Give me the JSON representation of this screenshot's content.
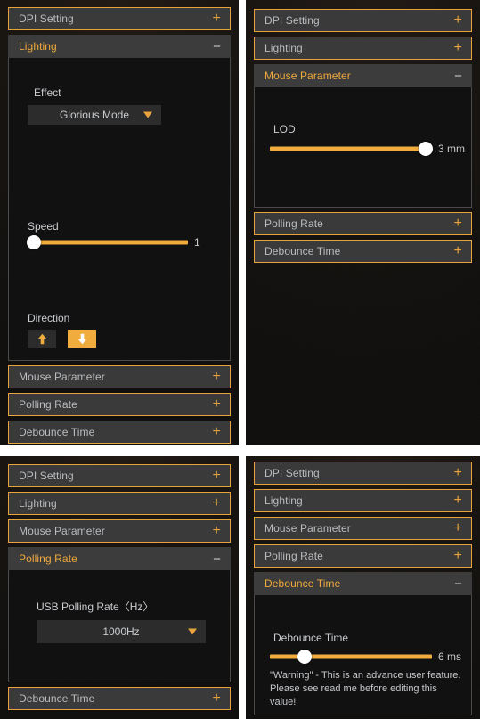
{
  "colors": {
    "accent": "#e8a33d",
    "accent_bright": "#f0ad3e",
    "header_bg": "#3a3a3a",
    "panel_bg": "#121111",
    "text": "#c9ccd0",
    "knob": "#ffffff"
  },
  "sections": {
    "dpi_setting": "DPI Setting",
    "lighting": "Lighting",
    "mouse_parameter": "Mouse Parameter",
    "polling_rate": "Polling Rate",
    "debounce_time": "Debounce Time"
  },
  "signs": {
    "collapsed": "+",
    "expanded": "−"
  },
  "panel_tl": {
    "rows": [
      {
        "label": "DPI Setting",
        "sign": "+"
      },
      {
        "label": "Lighting",
        "sign": "−"
      },
      {
        "label": "Mouse Parameter",
        "sign": "+"
      },
      {
        "label": "Polling Rate",
        "sign": "+"
      },
      {
        "label": "Debounce Time",
        "sign": "+"
      }
    ],
    "lighting": {
      "effect_label": "Effect",
      "effect_value": "Glorious Mode",
      "speed_label": "Speed",
      "speed_value": "1",
      "direction_label": "Direction",
      "direction_up": "up-arrow",
      "direction_down": "down-arrow",
      "direction_selected": "down"
    }
  },
  "panel_tr": {
    "rows": [
      {
        "label": "DPI Setting",
        "sign": "+"
      },
      {
        "label": "Lighting",
        "sign": "+"
      },
      {
        "label": "Mouse Parameter",
        "sign": "−"
      },
      {
        "label": "Polling Rate",
        "sign": "+"
      },
      {
        "label": "Debounce Time",
        "sign": "+"
      }
    ],
    "mouse_parameter": {
      "lod_label": "LOD",
      "lod_value": "3 mm"
    }
  },
  "panel_bl": {
    "rows": [
      {
        "label": "DPI Setting",
        "sign": "+"
      },
      {
        "label": "Lighting",
        "sign": "+"
      },
      {
        "label": "Mouse Parameter",
        "sign": "+"
      },
      {
        "label": "Polling Rate",
        "sign": "−"
      },
      {
        "label": "Debounce Time",
        "sign": "+"
      }
    ],
    "polling_rate": {
      "usb_label": "USB Polling Rate〈Hz〉",
      "usb_value": "1000Hz"
    }
  },
  "panel_br": {
    "rows": [
      {
        "label": "DPI Setting",
        "sign": "+"
      },
      {
        "label": "Lighting",
        "sign": "+"
      },
      {
        "label": "Mouse Parameter",
        "sign": "+"
      },
      {
        "label": "Polling Rate",
        "sign": "+"
      },
      {
        "label": "Debounce Time",
        "sign": "−"
      }
    ],
    "debounce": {
      "label": "Debounce Time",
      "value": "6 ms",
      "warning": "\"Warning\" - This is an advance user feature.\nPlease see read me before editing this value!"
    }
  }
}
